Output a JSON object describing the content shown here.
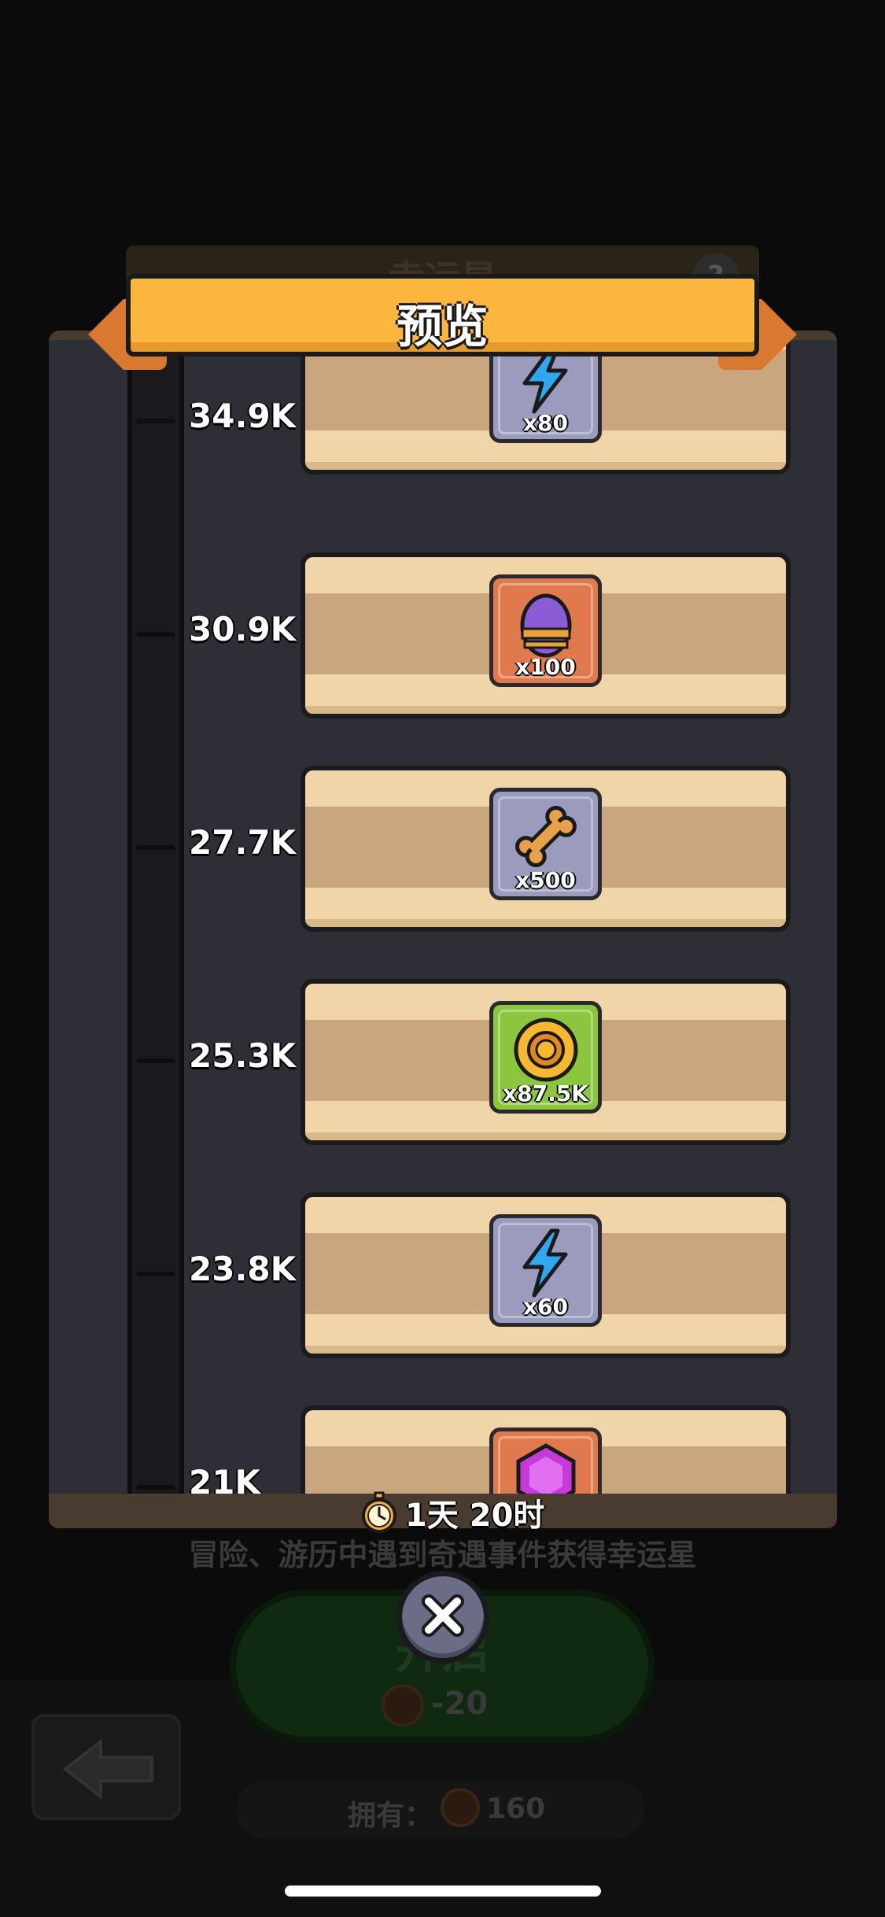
{
  "background": {
    "title": "幸运星",
    "help_icon": "question-icon",
    "description": "冒险、游历中遇到奇遇事件获得幸运星",
    "start_button_label": "开启",
    "cost": "-20",
    "owned_label": "拥有：",
    "owned_value": "160"
  },
  "modal": {
    "title": "预览",
    "timer": "1天 20时",
    "close_icon": "close-icon"
  },
  "rewards": [
    {
      "threshold": "34.9K",
      "item": "lightning-icon",
      "quantity": "x80",
      "tile_color": "#9b9cbd"
    },
    {
      "threshold": "30.9K",
      "item": "egg-icon",
      "quantity": "x100",
      "tile_color": "#e07a4e"
    },
    {
      "threshold": "27.7K",
      "item": "bone-icon",
      "quantity": "x500",
      "tile_color": "#9b9cbd"
    },
    {
      "threshold": "25.3K",
      "item": "gold-coin-icon",
      "quantity": "x87.5K",
      "tile_color": "#8cc63f"
    },
    {
      "threshold": "23.8K",
      "item": "lightning-icon",
      "quantity": "x60",
      "tile_color": "#9b9cbd"
    },
    {
      "threshold": "21K",
      "item": "gem-icon",
      "quantity": "",
      "tile_color": "#e07a4e"
    }
  ]
}
